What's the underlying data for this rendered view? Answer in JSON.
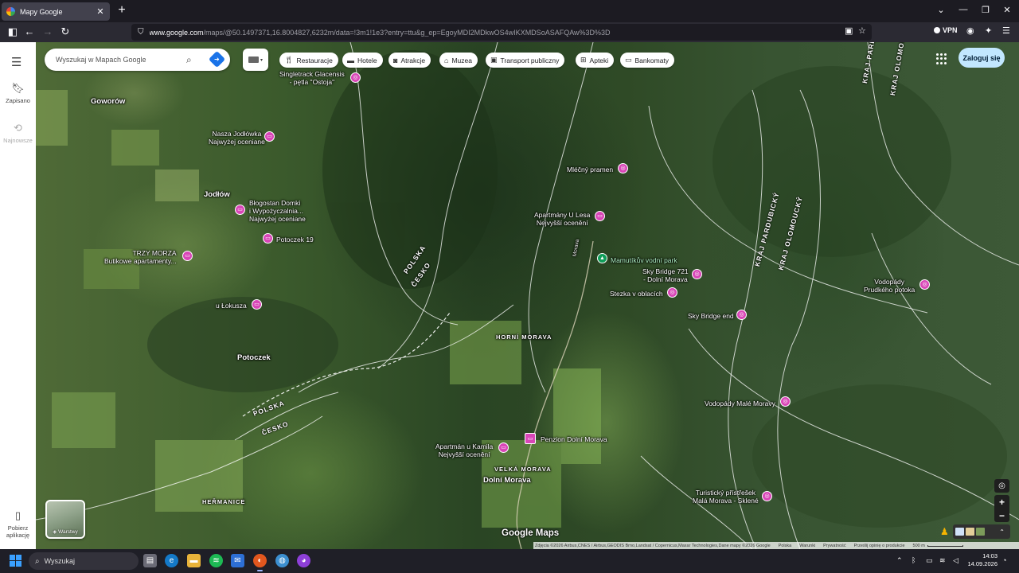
{
  "browser": {
    "tab_title": "Mapy Google",
    "url_host": "www.google.com",
    "url_rest": "/maps/@50.1497371,16.8004827,6232m/data=!3m1!1e3?entry=ttu&g_ep=EgoyMDI2MDkwOS4wIKXMDSoASAFQAw%3D%3D",
    "vpn_label": "VPN"
  },
  "rail": {
    "saved_label": "Zapisano",
    "recent_label": "Najnowsze",
    "get_app_label": "Pobierz aplikację"
  },
  "search": {
    "placeholder": "Wyszukaj w Mapach Google"
  },
  "chips": [
    {
      "label": "Restauracje",
      "icon": "fork-knife-icon"
    },
    {
      "label": "Hotele",
      "icon": "bed-icon"
    },
    {
      "label": "Atrakcje",
      "icon": "camera-icon"
    },
    {
      "label": "Muzea",
      "icon": "museum-icon"
    },
    {
      "label": "Transport publiczny",
      "icon": "bus-icon"
    },
    {
      "label": "Apteki",
      "icon": "pharmacy-icon"
    },
    {
      "label": "Bankomaty",
      "icon": "atm-icon"
    }
  ],
  "signin_label": "Zaloguj się",
  "layers_label": "Warstwy",
  "map": {
    "places": [
      {
        "name": "Singletrack Glacensis",
        "line2": "- pętla \"Ostoja\""
      },
      {
        "name": "Nasza Jodłówka",
        "sub": "Najwyżej oceniane"
      },
      {
        "name": "Błogostan Domki",
        "line2": "i Wypożyczalnia...",
        "sub": "Najwyżej oceniane"
      },
      {
        "name": "Potoczek 19"
      },
      {
        "name": "TRZY MORZA",
        "line2": "Butikowe apartamenty..."
      },
      {
        "name": "u Łokusza"
      },
      {
        "name": "Mléčný pramen"
      },
      {
        "name": "Apartmány U Lesa",
        "sub": "Nejvyšší ocenění"
      },
      {
        "name": "Mamutíkův vodní park"
      },
      {
        "name": "Sky Bridge 721",
        "line2": "- Dolní Morava"
      },
      {
        "name": "Stezka v oblacích"
      },
      {
        "name": "Sky Bridge end"
      },
      {
        "name": "Vodopády",
        "line2": "Prudkého potoka"
      },
      {
        "name": "Vodopády Malé Moravy"
      },
      {
        "name": "Apartmán u Kamila",
        "sub": "Nejvyšší ocenění"
      },
      {
        "name": "Penzion Dolní Morava"
      },
      {
        "name": "Turistický přístřešek",
        "line2": "Malá Morava - Sklené"
      }
    ],
    "towns": [
      "Goworów",
      "Jodłów",
      "Potoczek",
      "Dolní Morava"
    ],
    "villages": [
      "HORNÍ MORAVA",
      "VELKÁ MORAVA",
      "HEŘMANICE"
    ],
    "borders": [
      "POLSKA",
      "ČESKO",
      "KRAJ PARDUBICKÝ",
      "KRAJ OLOMOUCKÝ",
      "KRAJ PARD",
      "KRAJ OLOMOU"
    ],
    "road_label": "Morava"
  },
  "logo_text": "Google Maps",
  "attribution": {
    "imagery": "Zdjęcia ©2026 Airbus,CNES / Airbus,GEODIS Brno,Landsat / Copernicus,Maxar Technologies,Dane mapy ©2026 Google",
    "country": "Polska",
    "terms": "Warunki",
    "privacy": "Prywatność",
    "feedback": "Prześlij opinię o produkcie",
    "scale": "500 m"
  },
  "taskbar": {
    "search_label": "Wyszukaj",
    "time": "14:03",
    "date": "14.09.2026"
  },
  "colors": {
    "pin_magenta": "#d946b7",
    "pin_green": "#0f9d58",
    "signin_bg": "#c2e7ff",
    "directions_blue": "#1a73e8"
  }
}
